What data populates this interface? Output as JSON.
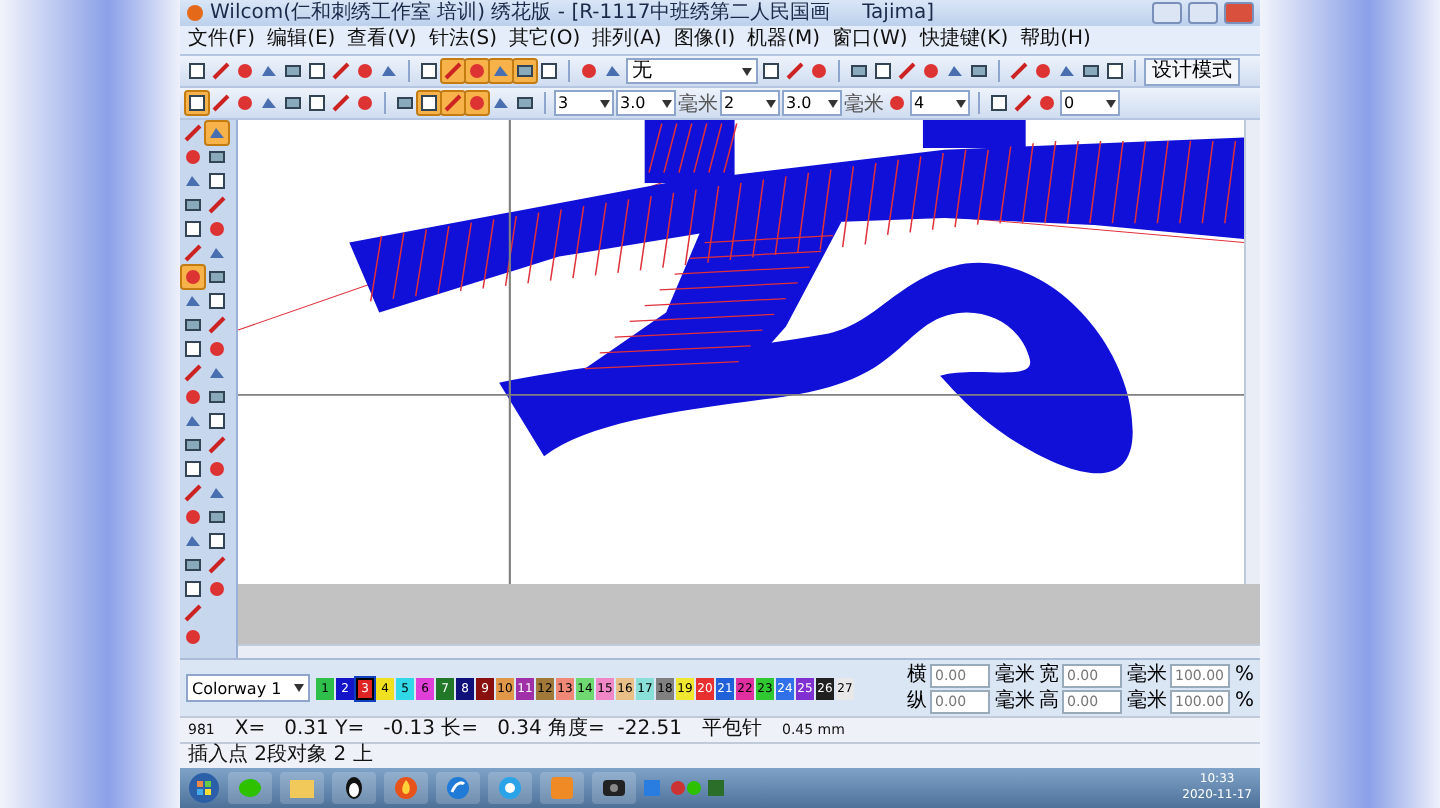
{
  "window": {
    "title": "Wilcom(仁和刺绣工作室 培训) 绣花版 - [R-1117中班绣第二人民国画     Tajima]"
  },
  "menu": [
    "文件(F)",
    "编辑(E)",
    "查看(V)",
    "针法(S)",
    "其它(O)",
    "排列(A)",
    "图像(I)",
    "机器(M)",
    "窗口(W)",
    "快捷键(K)",
    "帮助(H)"
  ],
  "toolbar_1": [
    {
      "kind": "icon",
      "selected": false
    },
    {
      "kind": "icon",
      "selected": false
    },
    {
      "kind": "icon",
      "selected": false
    },
    {
      "kind": "icon",
      "selected": false
    },
    {
      "kind": "icon",
      "selected": false
    },
    {
      "kind": "icon",
      "selected": false
    },
    {
      "kind": "icon",
      "selected": false
    },
    {
      "kind": "icon",
      "selected": false
    },
    {
      "kind": "icon",
      "selected": false
    },
    {
      "kind": "sep"
    },
    {
      "kind": "icon",
      "selected": false
    },
    {
      "kind": "icon",
      "selected": true
    },
    {
      "kind": "icon",
      "selected": true
    },
    {
      "kind": "icon",
      "selected": true
    },
    {
      "kind": "icon",
      "selected": true
    },
    {
      "kind": "icon",
      "selected": false
    },
    {
      "kind": "sep"
    },
    {
      "kind": "icon",
      "selected": false
    },
    {
      "kind": "icon",
      "selected": false
    },
    {
      "kind": "dropdown",
      "value": "无"
    },
    {
      "kind": "icon",
      "selected": false
    },
    {
      "kind": "icon",
      "selected": false
    },
    {
      "kind": "icon",
      "selected": false
    },
    {
      "kind": "sep"
    },
    {
      "kind": "icon",
      "selected": false
    },
    {
      "kind": "icon",
      "selected": false
    },
    {
      "kind": "icon",
      "selected": false
    },
    {
      "kind": "icon",
      "selected": false
    },
    {
      "kind": "icon",
      "selected": false
    },
    {
      "kind": "icon",
      "selected": false
    },
    {
      "kind": "sep"
    },
    {
      "kind": "icon",
      "selected": false
    },
    {
      "kind": "icon",
      "selected": false
    },
    {
      "kind": "icon",
      "selected": false
    },
    {
      "kind": "icon",
      "selected": false
    },
    {
      "kind": "icon",
      "selected": false
    },
    {
      "kind": "sep"
    },
    {
      "kind": "button",
      "value": "设计模式"
    }
  ],
  "toolbar_2": [
    {
      "kind": "icon",
      "selected": true
    },
    {
      "kind": "icon",
      "selected": false
    },
    {
      "kind": "icon",
      "selected": false
    },
    {
      "kind": "icon",
      "selected": false
    },
    {
      "kind": "icon",
      "selected": false
    },
    {
      "kind": "icon",
      "selected": false
    },
    {
      "kind": "icon",
      "selected": false
    },
    {
      "kind": "icon",
      "selected": false
    },
    {
      "kind": "sep"
    },
    {
      "kind": "icon",
      "selected": false
    },
    {
      "kind": "icon",
      "selected": true
    },
    {
      "kind": "icon",
      "selected": true
    },
    {
      "kind": "icon",
      "selected": true
    },
    {
      "kind": "icon",
      "selected": false
    },
    {
      "kind": "icon",
      "selected": false
    },
    {
      "kind": "sep"
    },
    {
      "kind": "spin",
      "value": "3"
    },
    {
      "kind": "spin",
      "value": "3.0"
    },
    {
      "kind": "unit",
      "value": "毫米"
    },
    {
      "kind": "spin",
      "value": "2"
    },
    {
      "kind": "spin",
      "value": "3.0"
    },
    {
      "kind": "unit",
      "value": "毫米"
    },
    {
      "kind": "icon",
      "selected": false
    },
    {
      "kind": "spin",
      "value": "4"
    },
    {
      "kind": "sep"
    },
    {
      "kind": "icon",
      "selected": false
    },
    {
      "kind": "icon",
      "selected": false
    },
    {
      "kind": "icon",
      "selected": false
    },
    {
      "kind": "spin",
      "value": "0"
    }
  ],
  "toolbox": {
    "column_1": [
      {
        "selected": false
      },
      {
        "selected": false
      },
      {
        "selected": false
      },
      {
        "selected": false
      },
      {
        "selected": false
      },
      {
        "selected": false
      },
      {
        "selected": true
      },
      {
        "selected": false
      },
      {
        "selected": false
      },
      {
        "selected": false
      },
      {
        "selected": false
      },
      {
        "selected": false
      },
      {
        "selected": false
      },
      {
        "selected": false
      },
      {
        "selected": false
      },
      {
        "selected": false
      },
      {
        "selected": false
      },
      {
        "selected": false
      },
      {
        "selected": false
      },
      {
        "selected": false
      },
      {
        "selected": false
      },
      {
        "selected": false
      }
    ],
    "column_2": [
      {
        "selected": true
      },
      {
        "selected": false
      },
      {
        "selected": false
      },
      {
        "selected": false
      },
      {
        "selected": false
      },
      {
        "selected": false
      },
      {
        "selected": false
      },
      {
        "selected": false
      },
      {
        "selected": false
      },
      {
        "selected": false
      },
      {
        "selected": false
      },
      {
        "selected": false
      },
      {
        "selected": false
      },
      {
        "selected": false
      },
      {
        "selected": false
      },
      {
        "selected": false
      },
      {
        "selected": false
      },
      {
        "selected": false
      },
      {
        "selected": false
      },
      {
        "selected": false
      }
    ]
  },
  "palette": {
    "colorway": "Colorway 1",
    "colors": [
      {
        "label": "1",
        "color": "#2ec04a",
        "selected": false
      },
      {
        "label": "2",
        "color": "#1414c8",
        "selected": false
      },
      {
        "label": "3",
        "color": "#e02424",
        "selected": true
      },
      {
        "label": "4",
        "color": "#f0e020",
        "selected": false
      },
      {
        "label": "5",
        "color": "#30d8e8",
        "selected": false
      },
      {
        "label": "6",
        "color": "#e040d8",
        "selected": false
      },
      {
        "label": "7",
        "color": "#207828",
        "selected": false
      },
      {
        "label": "8",
        "color": "#10107a",
        "selected": false
      },
      {
        "label": "9",
        "color": "#8a1010",
        "selected": false
      },
      {
        "label": "10",
        "color": "#e09848",
        "selected": false
      },
      {
        "label": "11",
        "color": "#a030a8",
        "selected": false
      },
      {
        "label": "12",
        "color": "#a07838",
        "selected": false
      },
      {
        "label": "13",
        "color": "#f08878",
        "selected": false
      },
      {
        "label": "14",
        "color": "#70d870",
        "selected": false
      },
      {
        "label": "15",
        "color": "#f088c8",
        "selected": false
      },
      {
        "label": "16",
        "color": "#e8c088",
        "selected": false
      },
      {
        "label": "17",
        "color": "#88e0d8",
        "selected": false
      },
      {
        "label": "18",
        "color": "#808080",
        "selected": false
      },
      {
        "label": "19",
        "color": "#f0e830",
        "selected": false
      },
      {
        "label": "20",
        "color": "#e83030",
        "selected": false
      },
      {
        "label": "21",
        "color": "#2060d8",
        "selected": false
      },
      {
        "label": "22",
        "color": "#e030a0",
        "selected": false
      },
      {
        "label": "23",
        "color": "#30c830",
        "selected": false
      },
      {
        "label": "24",
        "color": "#3070e8",
        "selected": false
      },
      {
        "label": "25",
        "color": "#8030d0",
        "selected": false
      },
      {
        "label": "26",
        "color": "#202020",
        "selected": false
      },
      {
        "label": "27",
        "color": "#e8e8e8",
        "selected": false
      }
    ]
  },
  "transform": {
    "rows": [
      {
        "pos_label": "横",
        "pos_value": "0.00",
        "pos_unit": "毫米",
        "size_label": "宽",
        "size_value": "0.00",
        "size_unit": "毫米",
        "scale": "100.00",
        "scale_unit": "%"
      },
      {
        "pos_label": "纵",
        "pos_value": "0.00",
        "pos_unit": "毫米",
        "size_label": "高",
        "size_value": "0.00",
        "size_unit": "毫米",
        "scale": "100.00",
        "scale_unit": "%"
      }
    ]
  },
  "status_bar": {
    "stitch_count": "981",
    "coordinates": "X=   0.31 Y=   -0.13 长=   0.34 角度=  -22.51",
    "stitch_type": "平包针",
    "length": "0.45 mm"
  },
  "hint_bar": "插入点 2段对象 2 上",
  "taskbar": {
    "time": "10:33",
    "date": "2020-11-17"
  }
}
